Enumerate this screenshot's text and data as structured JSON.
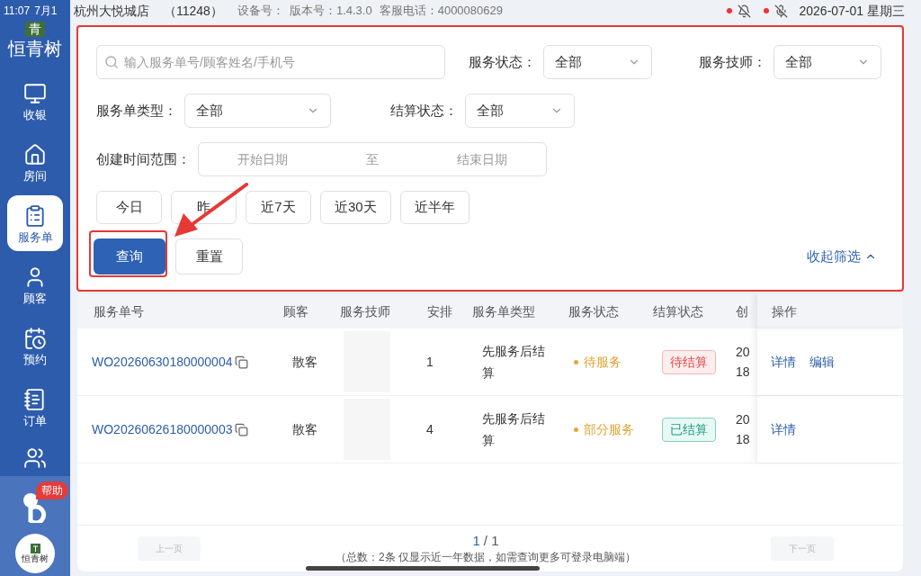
{
  "status_bar": {
    "time": "11:07",
    "date_fragment": "7月1",
    "store": "杭州大悦城店",
    "store_code": "（11248）",
    "device": "设备号：",
    "version": "版本号：1.4.3.0",
    "hotline": "客服电话：4000080629",
    "datetime": "2026-07-01 星期三"
  },
  "sidebar": {
    "brand_mark": "青",
    "brand": "恒青树",
    "items": [
      {
        "kind": "cashier",
        "label": "收银",
        "selected": false
      },
      {
        "kind": "room",
        "label": "房间",
        "selected": false
      },
      {
        "kind": "service",
        "label": "服务单",
        "selected": true
      },
      {
        "kind": "customer",
        "label": "顾客",
        "selected": false
      },
      {
        "kind": "booking",
        "label": "预约",
        "selected": false
      },
      {
        "kind": "order",
        "label": "订单",
        "selected": false
      },
      {
        "kind": "staff",
        "selected": false
      }
    ],
    "help_badge": "帮助",
    "footer_logo": "恒青树"
  },
  "filters": {
    "search_placeholder": "输入服务单号/顾客姓名/手机号",
    "selects": [
      {
        "label": "服务状态：",
        "value": "全部"
      },
      {
        "label": "服务技师：",
        "value": "全部"
      },
      {
        "label": "服务单类型：",
        "value": "全部"
      },
      {
        "label": "结算状态：",
        "value": "全部"
      }
    ],
    "date_range": {
      "label": "创建时间范围：",
      "start_placeholder": "开始日期",
      "separator": "至",
      "end_placeholder": "结束日期"
    },
    "quick_ranges": [
      "今日",
      "昨",
      "近7天",
      "近30天",
      "近半年"
    ],
    "query_button": "查询",
    "reset_button": "重置",
    "collapse": "收起筛选"
  },
  "table": {
    "columns": [
      "服务单号",
      "顾客",
      "服务技师",
      "安排",
      "服务单类型",
      "服务状态",
      "结算状态",
      "创",
      "操作"
    ],
    "rows": [
      {
        "order_no": "WO20260630180000004",
        "customer": "散客",
        "arrangement": "1",
        "type": "先服务后结算",
        "service_status": "待服务",
        "settlement": {
          "kind": "pending",
          "text": "待结算"
        },
        "created": [
          "20",
          "18"
        ],
        "actions": [
          "详情",
          "编辑"
        ]
      },
      {
        "order_no": "WO20260626180000003",
        "customer": "散客",
        "arrangement": "4",
        "type": "先服务后结算",
        "service_status": "部分服务",
        "settlement": {
          "kind": "settled",
          "text": "已结算"
        },
        "created": [
          "20",
          "18"
        ],
        "actions": [
          "详情"
        ]
      }
    ]
  },
  "pagination": {
    "prev": "上一页",
    "current": "1",
    "total": "/ 1",
    "next": "下一页",
    "note": "（总数：2条 仅显示近一年数据，如需查询更多可登录电脑端）"
  }
}
